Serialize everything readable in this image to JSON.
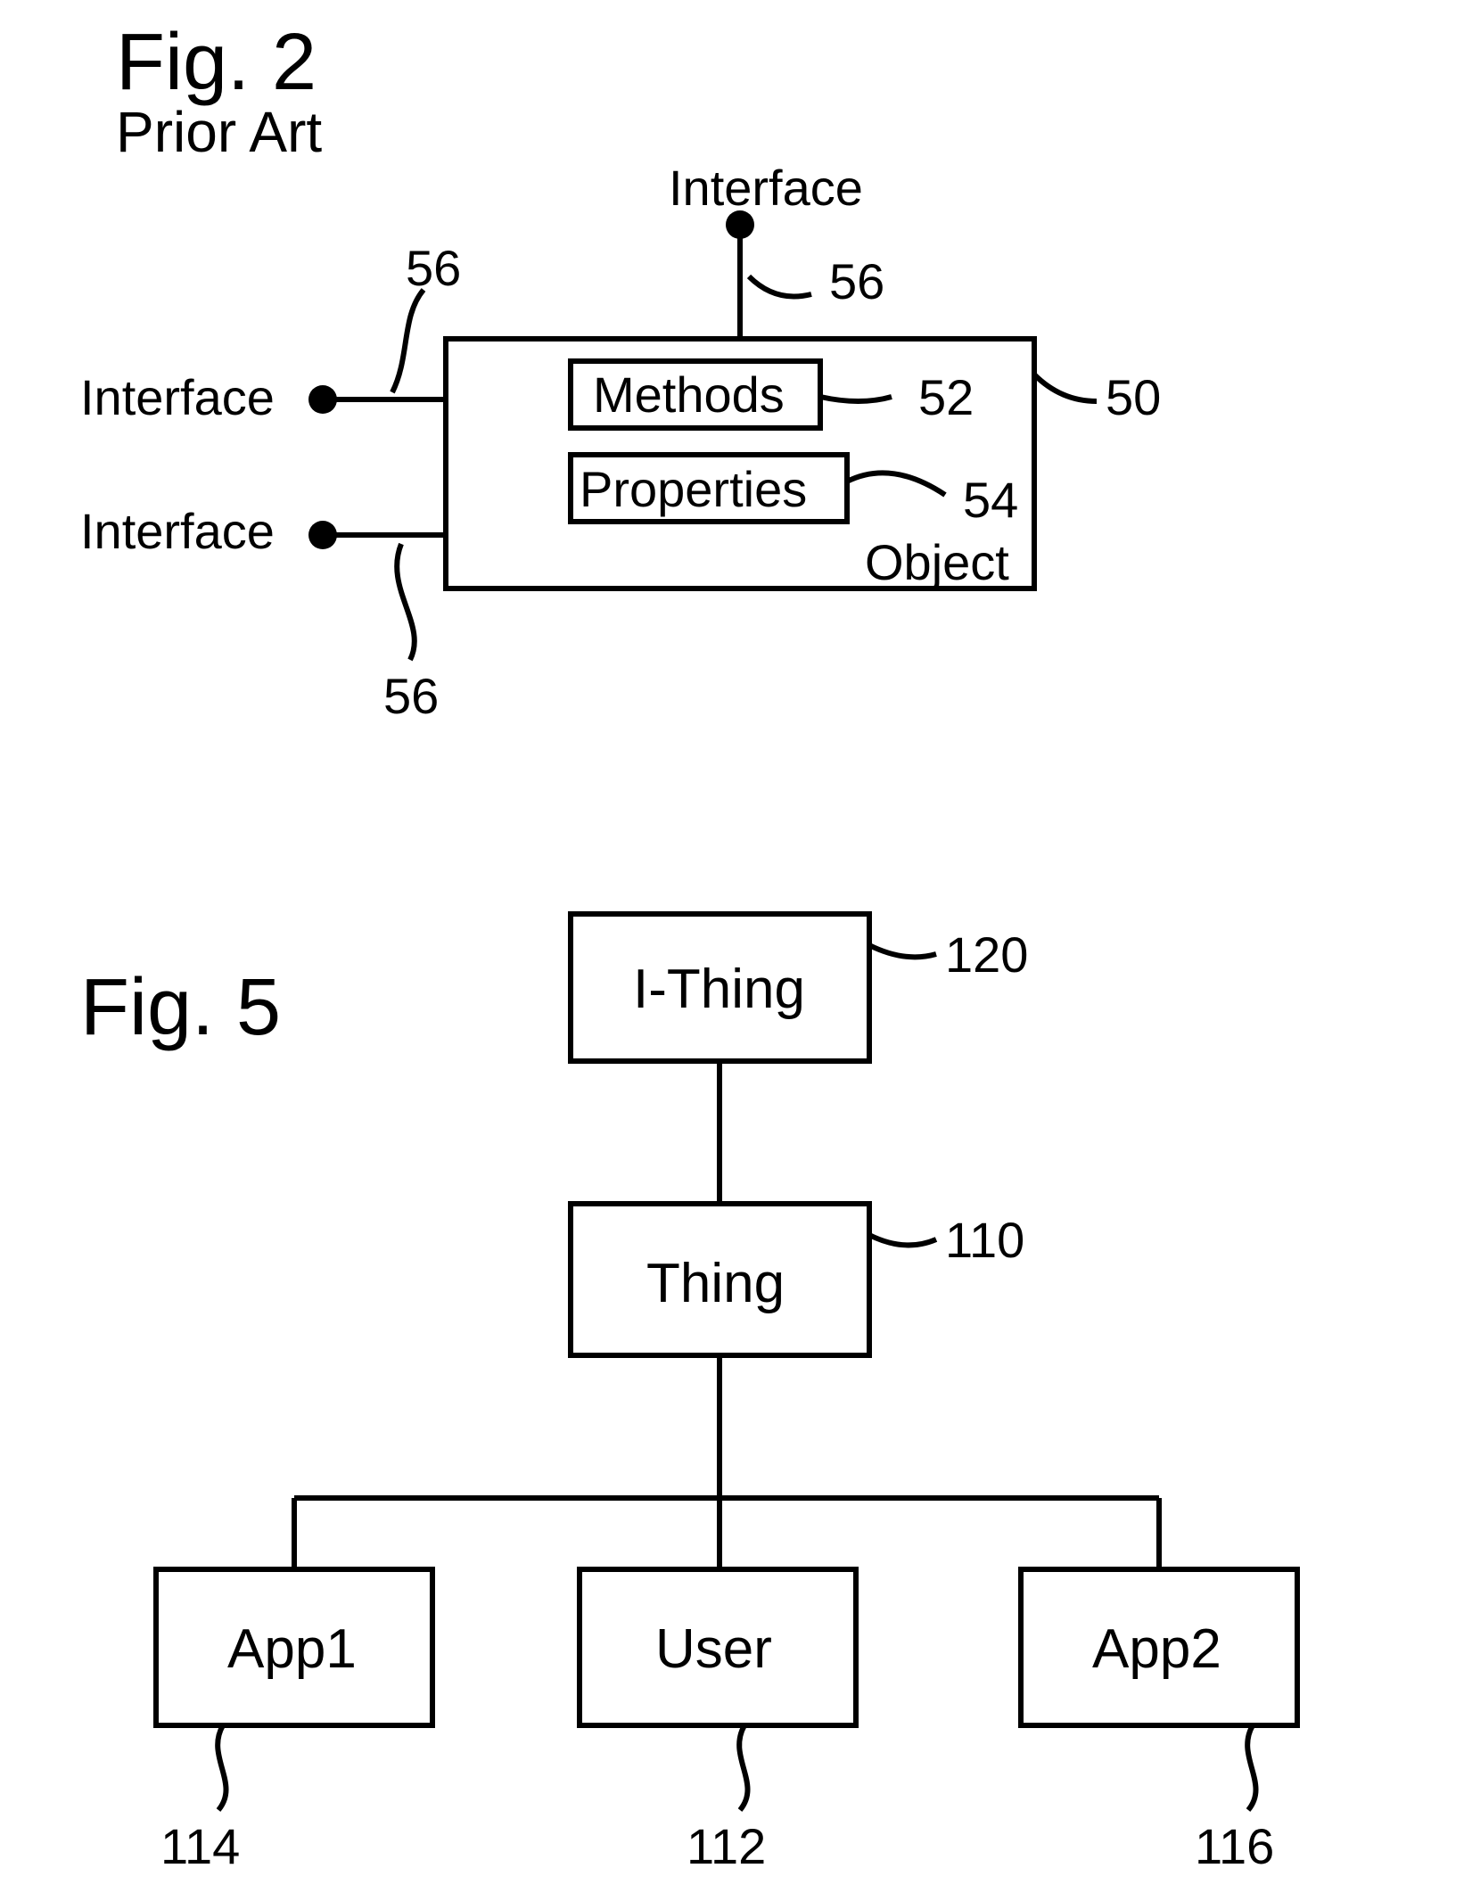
{
  "fig2": {
    "title": "Fig. 2",
    "subtitle": "Prior Art",
    "interface_top": "Interface",
    "interface_left1": "Interface",
    "interface_left2": "Interface",
    "methods": "Methods",
    "properties": "Properties",
    "object": "Object",
    "ref_top": "56",
    "ref_left_top": "56",
    "ref_left_bottom": "56",
    "ref_methods": "52",
    "ref_properties": "54",
    "ref_object": "50"
  },
  "fig5": {
    "title": "Fig. 5",
    "ithing": "I-Thing",
    "thing": "Thing",
    "app1": "App1",
    "user": "User",
    "app2": "App2",
    "ref_ithing": "120",
    "ref_thing": "110",
    "ref_app1": "114",
    "ref_user": "112",
    "ref_app2": "116"
  }
}
